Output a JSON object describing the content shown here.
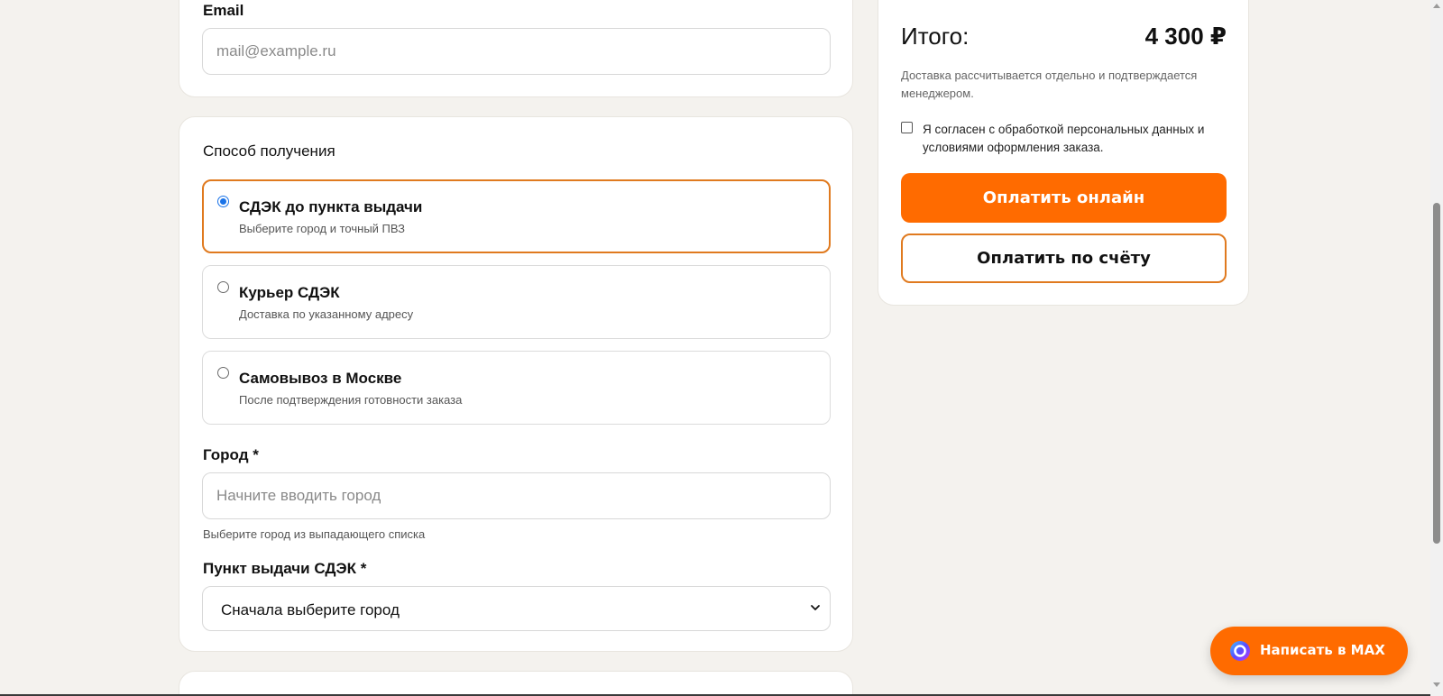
{
  "contact": {
    "email_label": "Email",
    "email_placeholder": "mail@example.ru",
    "email_value": ""
  },
  "delivery": {
    "section_title": "Способ получения",
    "options": [
      {
        "title": "СДЭК до пункта выдачи",
        "subtitle": "Выберите город и точный ПВЗ",
        "selected": true
      },
      {
        "title": "Курьер СДЭК",
        "subtitle": "Доставка по указанному адресу",
        "selected": false
      },
      {
        "title": "Самовывоз в Москве",
        "subtitle": "После подтверждения готовности заказа",
        "selected": false
      }
    ],
    "city_label": "Город *",
    "city_placeholder": "Начните вводить город",
    "city_value": "",
    "city_hint": "Выберите город из выпадающего списка",
    "pickup_label": "Пункт выдачи СДЭК *",
    "pickup_selected": "Сначала выберите город"
  },
  "summary": {
    "total_label": "Итого:",
    "total_value": "4 300 ₽",
    "note": "Доставка рассчитывается отдельно и подтверждается менеджером.",
    "consent_text": "Я согласен с обработкой персональных данных и условиями оформления заказа.",
    "consent_checked": false,
    "pay_online_label": "Оплатить онлайн",
    "pay_invoice_label": "Оплатить по счёту"
  },
  "chat": {
    "label": "Написать в MAX"
  },
  "colors": {
    "accent": "#ff6b00",
    "selected_border": "#e07a1f",
    "radio_blue": "#1a73e8",
    "background": "#f4f2ee"
  },
  "icons": {
    "chat": "max-logo-icon",
    "select": "chevron-down-icon"
  }
}
